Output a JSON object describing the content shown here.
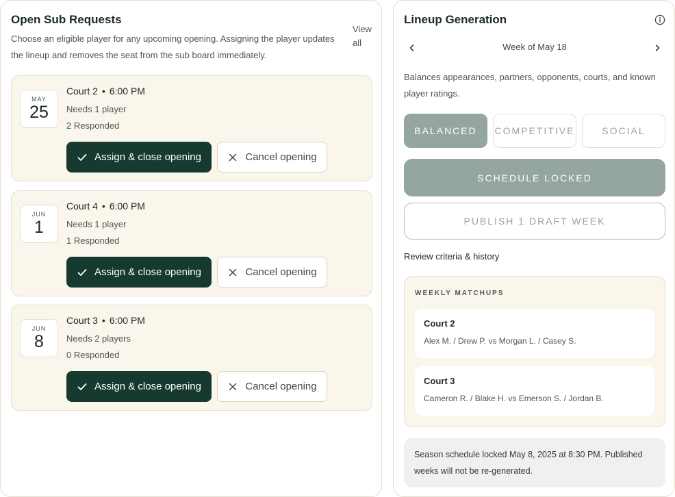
{
  "sub_requests": {
    "title": "Open Sub Requests",
    "description": "Choose an eligible player for any upcoming opening. Assigning the player updates the lineup and removes the seat from the sub board immediately.",
    "view_all": "View all",
    "assign_label": "Assign & close opening",
    "cancel_label": "Cancel opening",
    "items": [
      {
        "month": "MAY",
        "day": "25",
        "court": "Court 2",
        "time": "6:00 PM",
        "needs": "Needs 1 player",
        "responded": "2 Responded"
      },
      {
        "month": "JUN",
        "day": "1",
        "court": "Court 4",
        "time": "6:00 PM",
        "needs": "Needs 1 player",
        "responded": "1 Responded"
      },
      {
        "month": "JUN",
        "day": "8",
        "court": "Court 3",
        "time": "6:00 PM",
        "needs": "Needs 2 players",
        "responded": "0 Responded"
      }
    ]
  },
  "lineup": {
    "title": "Lineup Generation",
    "week_label": "Week of May 18",
    "description": "Balances appearances, partners, opponents, courts, and known player ratings.",
    "modes": [
      {
        "label": "BALANCED",
        "selected": true
      },
      {
        "label": "COMPETITIVE",
        "selected": false
      },
      {
        "label": "SOCIAL",
        "selected": false
      }
    ],
    "locked_label": "SCHEDULE LOCKED",
    "publish_label": "PUBLISH 1 DRAFT WEEK",
    "review_link": "Review criteria & history",
    "matchups_title": "WEEKLY MATCHUPS",
    "matchups": [
      {
        "court": "Court 2",
        "pairs": "Alex M. / Drew P. vs Morgan L. / Casey S."
      },
      {
        "court": "Court 3",
        "pairs": "Cameron R. / Blake H. vs Emerson S. / Jordan B."
      }
    ],
    "lock_note": "Season schedule locked May 8, 2025 at 8:30 PM. Published weeks will not be re-generated."
  },
  "colors": {
    "primary": "#173a30",
    "muted_green": "#94a69f",
    "card_bg": "#faf6ec",
    "border": "#e4dfcf"
  },
  "icons": {
    "assign": "check-icon",
    "cancel": "close-icon",
    "info": "info-icon",
    "prev": "chevron-left-icon",
    "next": "chevron-right-icon"
  }
}
